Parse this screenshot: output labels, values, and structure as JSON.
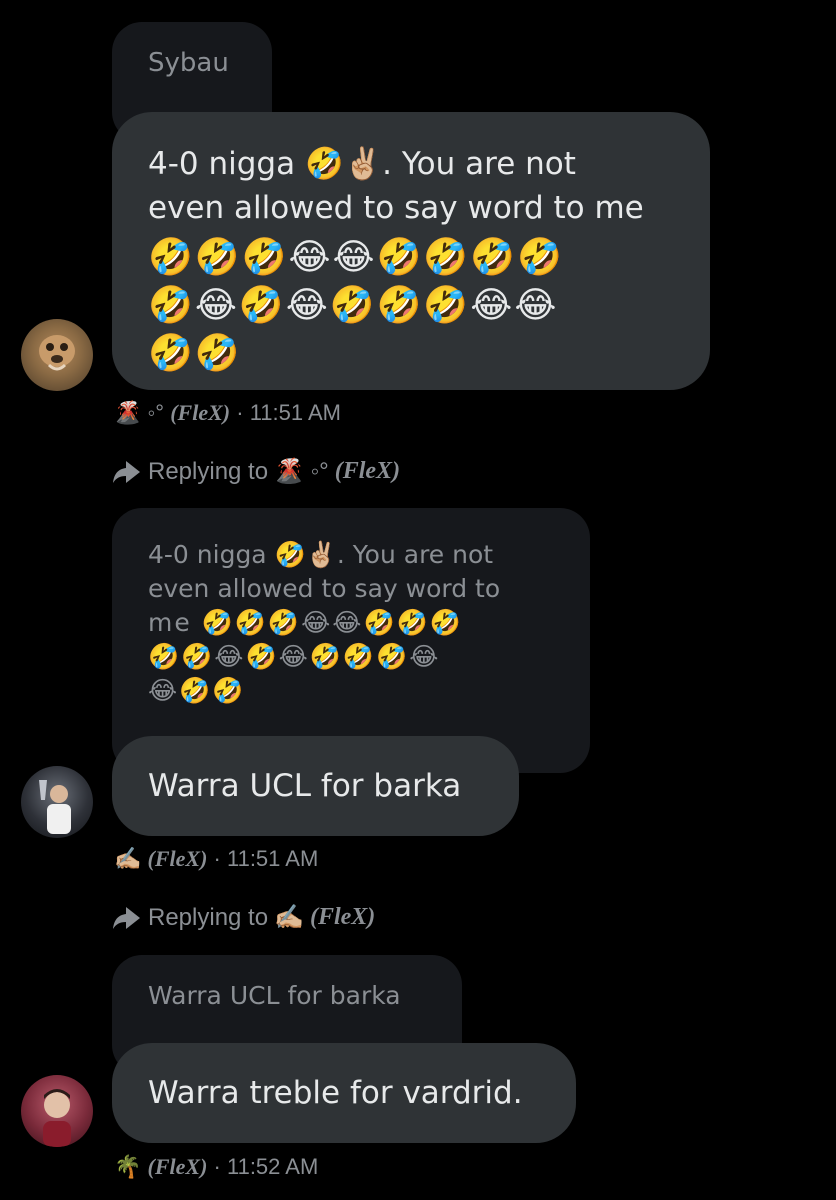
{
  "messages": [
    {
      "quote_text": "Sybau",
      "text": "4-0 nigga 🤣✌🏼. You are not",
      "text_line2": "even allowed to say word to me",
      "emoji_lines": [
        "🤣🤣🤣😂😂🤣🤣🤣🤣",
        "🤣😂🤣😂🤣🤣🤣😂😂",
        "🤣🤣"
      ],
      "sender_emoji": "🌋 ◦°",
      "sender_name": "(FleX)",
      "time": "· 11:51 AM"
    },
    {
      "replying_label": "Replying to",
      "replying_emoji": "🌋 ◦°",
      "replying_name": "(FleX)",
      "quote_lines": [
        "4-0 nigga 🤣✌🏼. You are not",
        "even allowed to say word to",
        "me 🤣🤣🤣😂😂🤣🤣🤣",
        "🤣🤣😂🤣😂🤣🤣🤣😂",
        "😂🤣🤣"
      ],
      "text": "Warra UCL for barka",
      "sender_emoji": "✍🏼",
      "sender_name": "(FleX)",
      "time": "· 11:51 AM"
    },
    {
      "replying_label": "Replying to",
      "replying_emoji": "✍🏼",
      "replying_name": "(FleX)",
      "quote_text": "Warra UCL for barka",
      "text": "Warra treble for vardrid.",
      "sender_emoji": "🌴",
      "sender_name": "(FleX)",
      "time": "· 11:52 AM"
    }
  ],
  "colors": {
    "background": "#000000",
    "bubble": "#2f3336",
    "quote": "#16181c",
    "meta": "#8b8f94"
  }
}
